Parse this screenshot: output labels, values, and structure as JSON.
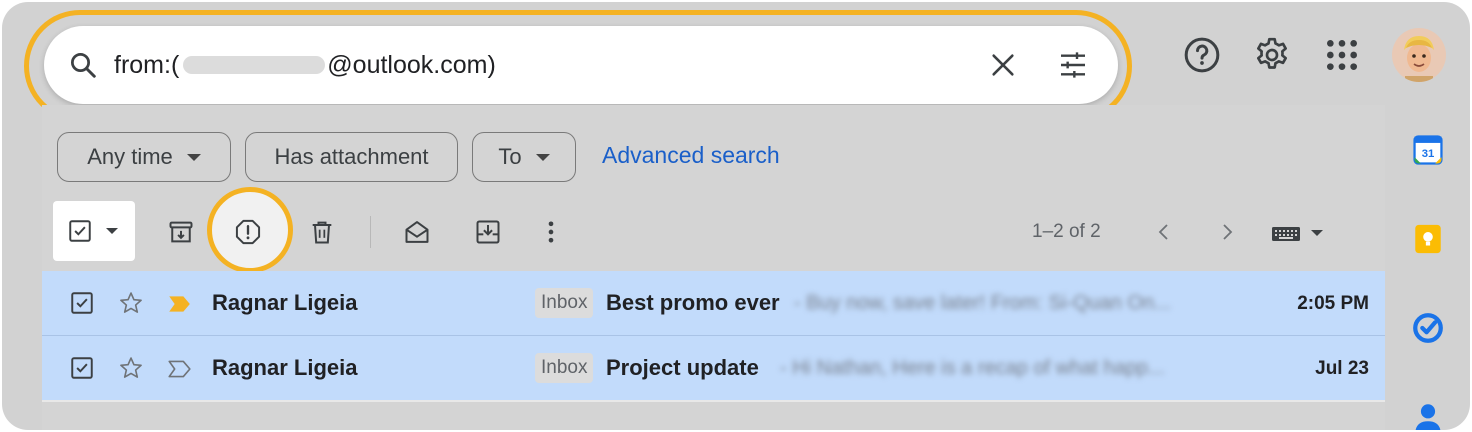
{
  "search": {
    "query_prefix": "from:(",
    "query_suffix": "@outlook.com)"
  },
  "filters": {
    "any_time": "Any time",
    "has_attachment": "Has attachment",
    "to": "To",
    "advanced_search": "Advanced search"
  },
  "toolbar": {
    "count": "1–2 of 2"
  },
  "emails": [
    {
      "sender": "Ragnar Ligeia",
      "label": "Inbox",
      "subject": "Best promo ever",
      "snippet": "- Buy now, save later! From: Si-Quan On...",
      "date": "2:05 PM",
      "important": true
    },
    {
      "sender": "Ragnar Ligeia",
      "label": "Inbox",
      "subject": "Project update",
      "snippet": "- Hi Nathan, Here is a recap of what happ...",
      "date": "Jul 23",
      "important": false
    }
  ],
  "colors": {
    "highlight": "#f4b223",
    "selected_row": "#c2dbfb",
    "link": "#1a5fc9",
    "important_marker": "#f4b223"
  }
}
